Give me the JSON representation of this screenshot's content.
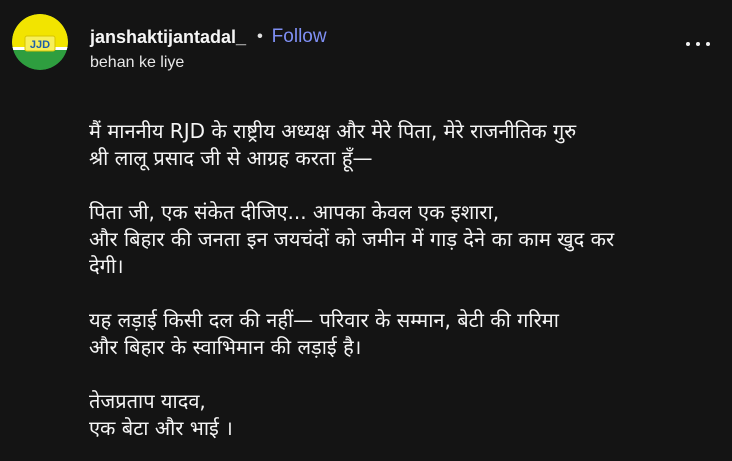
{
  "account": {
    "username": "janshaktijantadal_",
    "separator": "•",
    "follow_label": "Follow",
    "subtitle": "behan ke liye",
    "avatar_text": "JJD"
  },
  "colors": {
    "background": "#141414",
    "follow": "#7f8ff4",
    "avatar_top": "#f2e400",
    "avatar_bottom": "#2e9e3f"
  },
  "menu_icon": "more-horizontal-icon",
  "caption": {
    "paragraphs": [
      {
        "lines": [
          "मैं माननीय RJD के राष्ट्रीय अध्यक्ष और मेरे पिता, मेरे राजनीतिक गुरु",
          "श्री लालू प्रसाद जी से आग्रह करता हूँ—"
        ]
      },
      {
        "lines": [
          "पिता जी, एक संकेत दीजिए... आपका केवल एक इशारा,",
          "और बिहार की जनता इन जयचंदों को जमीन में गाड़ देने का काम खुद कर",
          "देगी।"
        ]
      },
      {
        "lines": [
          "यह लड़ाई किसी दल की नहीं— परिवार के सम्मान, बेटी की गरिमा",
          "और बिहार के स्वाभिमान की लड़ाई है।"
        ]
      },
      {
        "lines": [
          "तेजप्रताप यादव,",
          "एक बेटा और भाई ।"
        ]
      }
    ]
  }
}
